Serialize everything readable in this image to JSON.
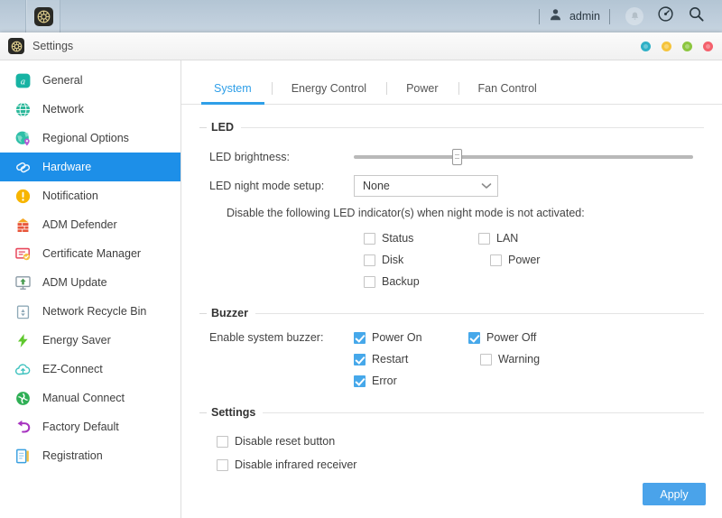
{
  "desktop": {
    "user": "admin",
    "icons": {
      "app_launcher": "gear-icon",
      "user": "user-icon",
      "notification": "bell-icon",
      "dashboard": "gauge-icon",
      "search": "search-icon"
    }
  },
  "window": {
    "title": "Settings",
    "buttons": [
      {
        "name": "pin",
        "color": "#2fb0c6"
      },
      {
        "name": "minimize",
        "color": "#f5c43c"
      },
      {
        "name": "maximize",
        "color": "#8cc63f"
      },
      {
        "name": "close",
        "color": "#f4606c"
      }
    ]
  },
  "sidebar": {
    "items": [
      {
        "label": "General",
        "icon": "general-icon",
        "color": "#18b3a6",
        "active": false
      },
      {
        "label": "Network",
        "icon": "globe-icon",
        "color": "#2bb89a",
        "active": false
      },
      {
        "label": "Regional Options",
        "icon": "regional-icon",
        "color": "#2fbfa8",
        "active": false
      },
      {
        "label": "Hardware",
        "icon": "hardware-icon",
        "color": "#ffffff",
        "active": true
      },
      {
        "label": "Notification",
        "icon": "notification-icon",
        "color": "#f7b500",
        "active": false
      },
      {
        "label": "ADM Defender",
        "icon": "firewall-icon",
        "color": "#e8553a",
        "active": false
      },
      {
        "label": "Certificate Manager",
        "icon": "certificate-icon",
        "color": "#e8485c",
        "active": false
      },
      {
        "label": "ADM Update",
        "icon": "update-icon",
        "color": "#4a9c52",
        "active": false
      },
      {
        "label": "Network Recycle Bin",
        "icon": "recycle-bin-icon",
        "color": "#7fa7bd",
        "active": false
      },
      {
        "label": "Energy Saver",
        "icon": "energy-saver-icon",
        "color": "#5fc82e",
        "active": false
      },
      {
        "label": "EZ-Connect",
        "icon": "cloud-upload-icon",
        "color": "#3fc2bf",
        "active": false
      },
      {
        "label": "Manual Connect",
        "icon": "manual-connect-icon",
        "color": "#2faf55",
        "active": false
      },
      {
        "label": "Factory Default",
        "icon": "undo-arrow-icon",
        "color": "#a734c0",
        "active": false
      },
      {
        "label": "Registration",
        "icon": "registration-icon",
        "color": "#3aa0e0",
        "active": false
      }
    ]
  },
  "tabs": [
    {
      "label": "System",
      "active": true
    },
    {
      "label": "Energy Control",
      "active": false
    },
    {
      "label": "Power",
      "active": false
    },
    {
      "label": "Fan Control",
      "active": false
    }
  ],
  "led": {
    "group_title": "LED",
    "brightness_label": "LED brightness:",
    "brightness_percent": 30,
    "night_mode_label": "LED night mode setup:",
    "night_mode_value": "None",
    "night_mode_options": [
      "None"
    ],
    "hint": "Disable the following LED indicator(s) when night mode is not activated:",
    "indicators": [
      {
        "label": "Status",
        "checked": false
      },
      {
        "label": "LAN",
        "checked": false
      },
      {
        "label": "Disk",
        "checked": false
      },
      {
        "label": "Power",
        "checked": false
      },
      {
        "label": "Backup",
        "checked": false
      }
    ]
  },
  "buzzer": {
    "group_title": "Buzzer",
    "label": "Enable system buzzer:",
    "options": [
      {
        "label": "Power On",
        "checked": true
      },
      {
        "label": "Power Off",
        "checked": true
      },
      {
        "label": "Restart",
        "checked": true
      },
      {
        "label": "Warning",
        "checked": false
      },
      {
        "label": "Error",
        "checked": true
      }
    ]
  },
  "settings": {
    "group_title": "Settings",
    "options": [
      {
        "label": "Disable reset button",
        "checked": false
      },
      {
        "label": "Disable infrared receiver",
        "checked": false
      }
    ]
  },
  "footer": {
    "apply_label": "Apply"
  },
  "colors": {
    "accent": "#2f9fe8",
    "sidebar_active": "#1d8fe8",
    "checkbox_checked": "#46a8ea",
    "apply_button": "#4aa3ea"
  }
}
